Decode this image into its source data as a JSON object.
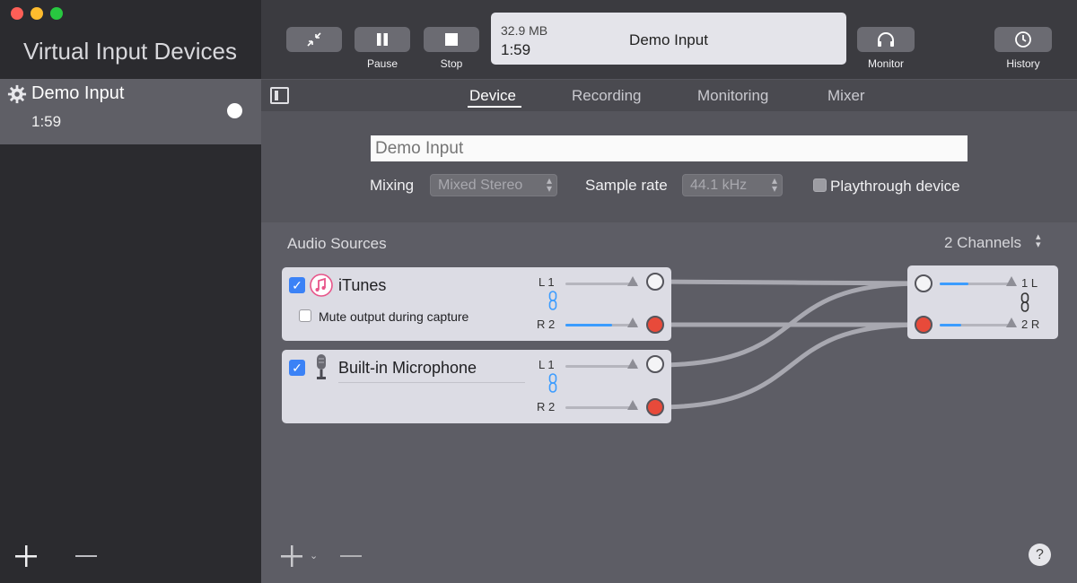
{
  "sidebar": {
    "title": "Virtual Input Devices",
    "items": [
      {
        "name": "Demo Input",
        "time": "1:59"
      }
    ]
  },
  "toolbar": {
    "pause_label": "Pause",
    "stop_label": "Stop",
    "monitor_label": "Monitor",
    "history_label": "History",
    "display": {
      "size": "32.9 MB",
      "time": "1:59",
      "name": "Demo Input"
    }
  },
  "tabs": [
    {
      "label": "Device",
      "active": true
    },
    {
      "label": "Recording",
      "active": false
    },
    {
      "label": "Monitoring",
      "active": false
    },
    {
      "label": "Mixer",
      "active": false
    }
  ],
  "device": {
    "name_placeholder": "Demo Input",
    "mixing_label": "Mixing",
    "mixing_value": "Mixed Stereo",
    "sample_rate_label": "Sample rate",
    "sample_rate_value": "44.1 kHz",
    "playthrough_label": "Playthrough device",
    "playthrough_checked": false
  },
  "audio_sources": {
    "title": "Audio Sources",
    "channels": "2 Channels",
    "sources": [
      {
        "name": "iTunes",
        "checked": true,
        "icon": "music-note-icon",
        "option_label": "Mute output during capture",
        "option_checked": false,
        "channels": [
          {
            "label": "L 1",
            "level": 0.0
          },
          {
            "label": "R 2",
            "level": 0.65
          }
        ]
      },
      {
        "name": "Built-in Microphone",
        "checked": true,
        "icon": "microphone-icon",
        "channels": [
          {
            "label": "L 1",
            "level": 0.0
          },
          {
            "label": "R 2",
            "level": 0.0
          }
        ]
      }
    ],
    "output": {
      "channels": [
        {
          "label": "1 L",
          "level": 0.38
        },
        {
          "label": "2 R",
          "level": 0.28
        }
      ]
    }
  },
  "colors": {
    "accent": "#3b9cff",
    "port_active": "#e84a3a",
    "checkbox": "#3b82f6"
  }
}
